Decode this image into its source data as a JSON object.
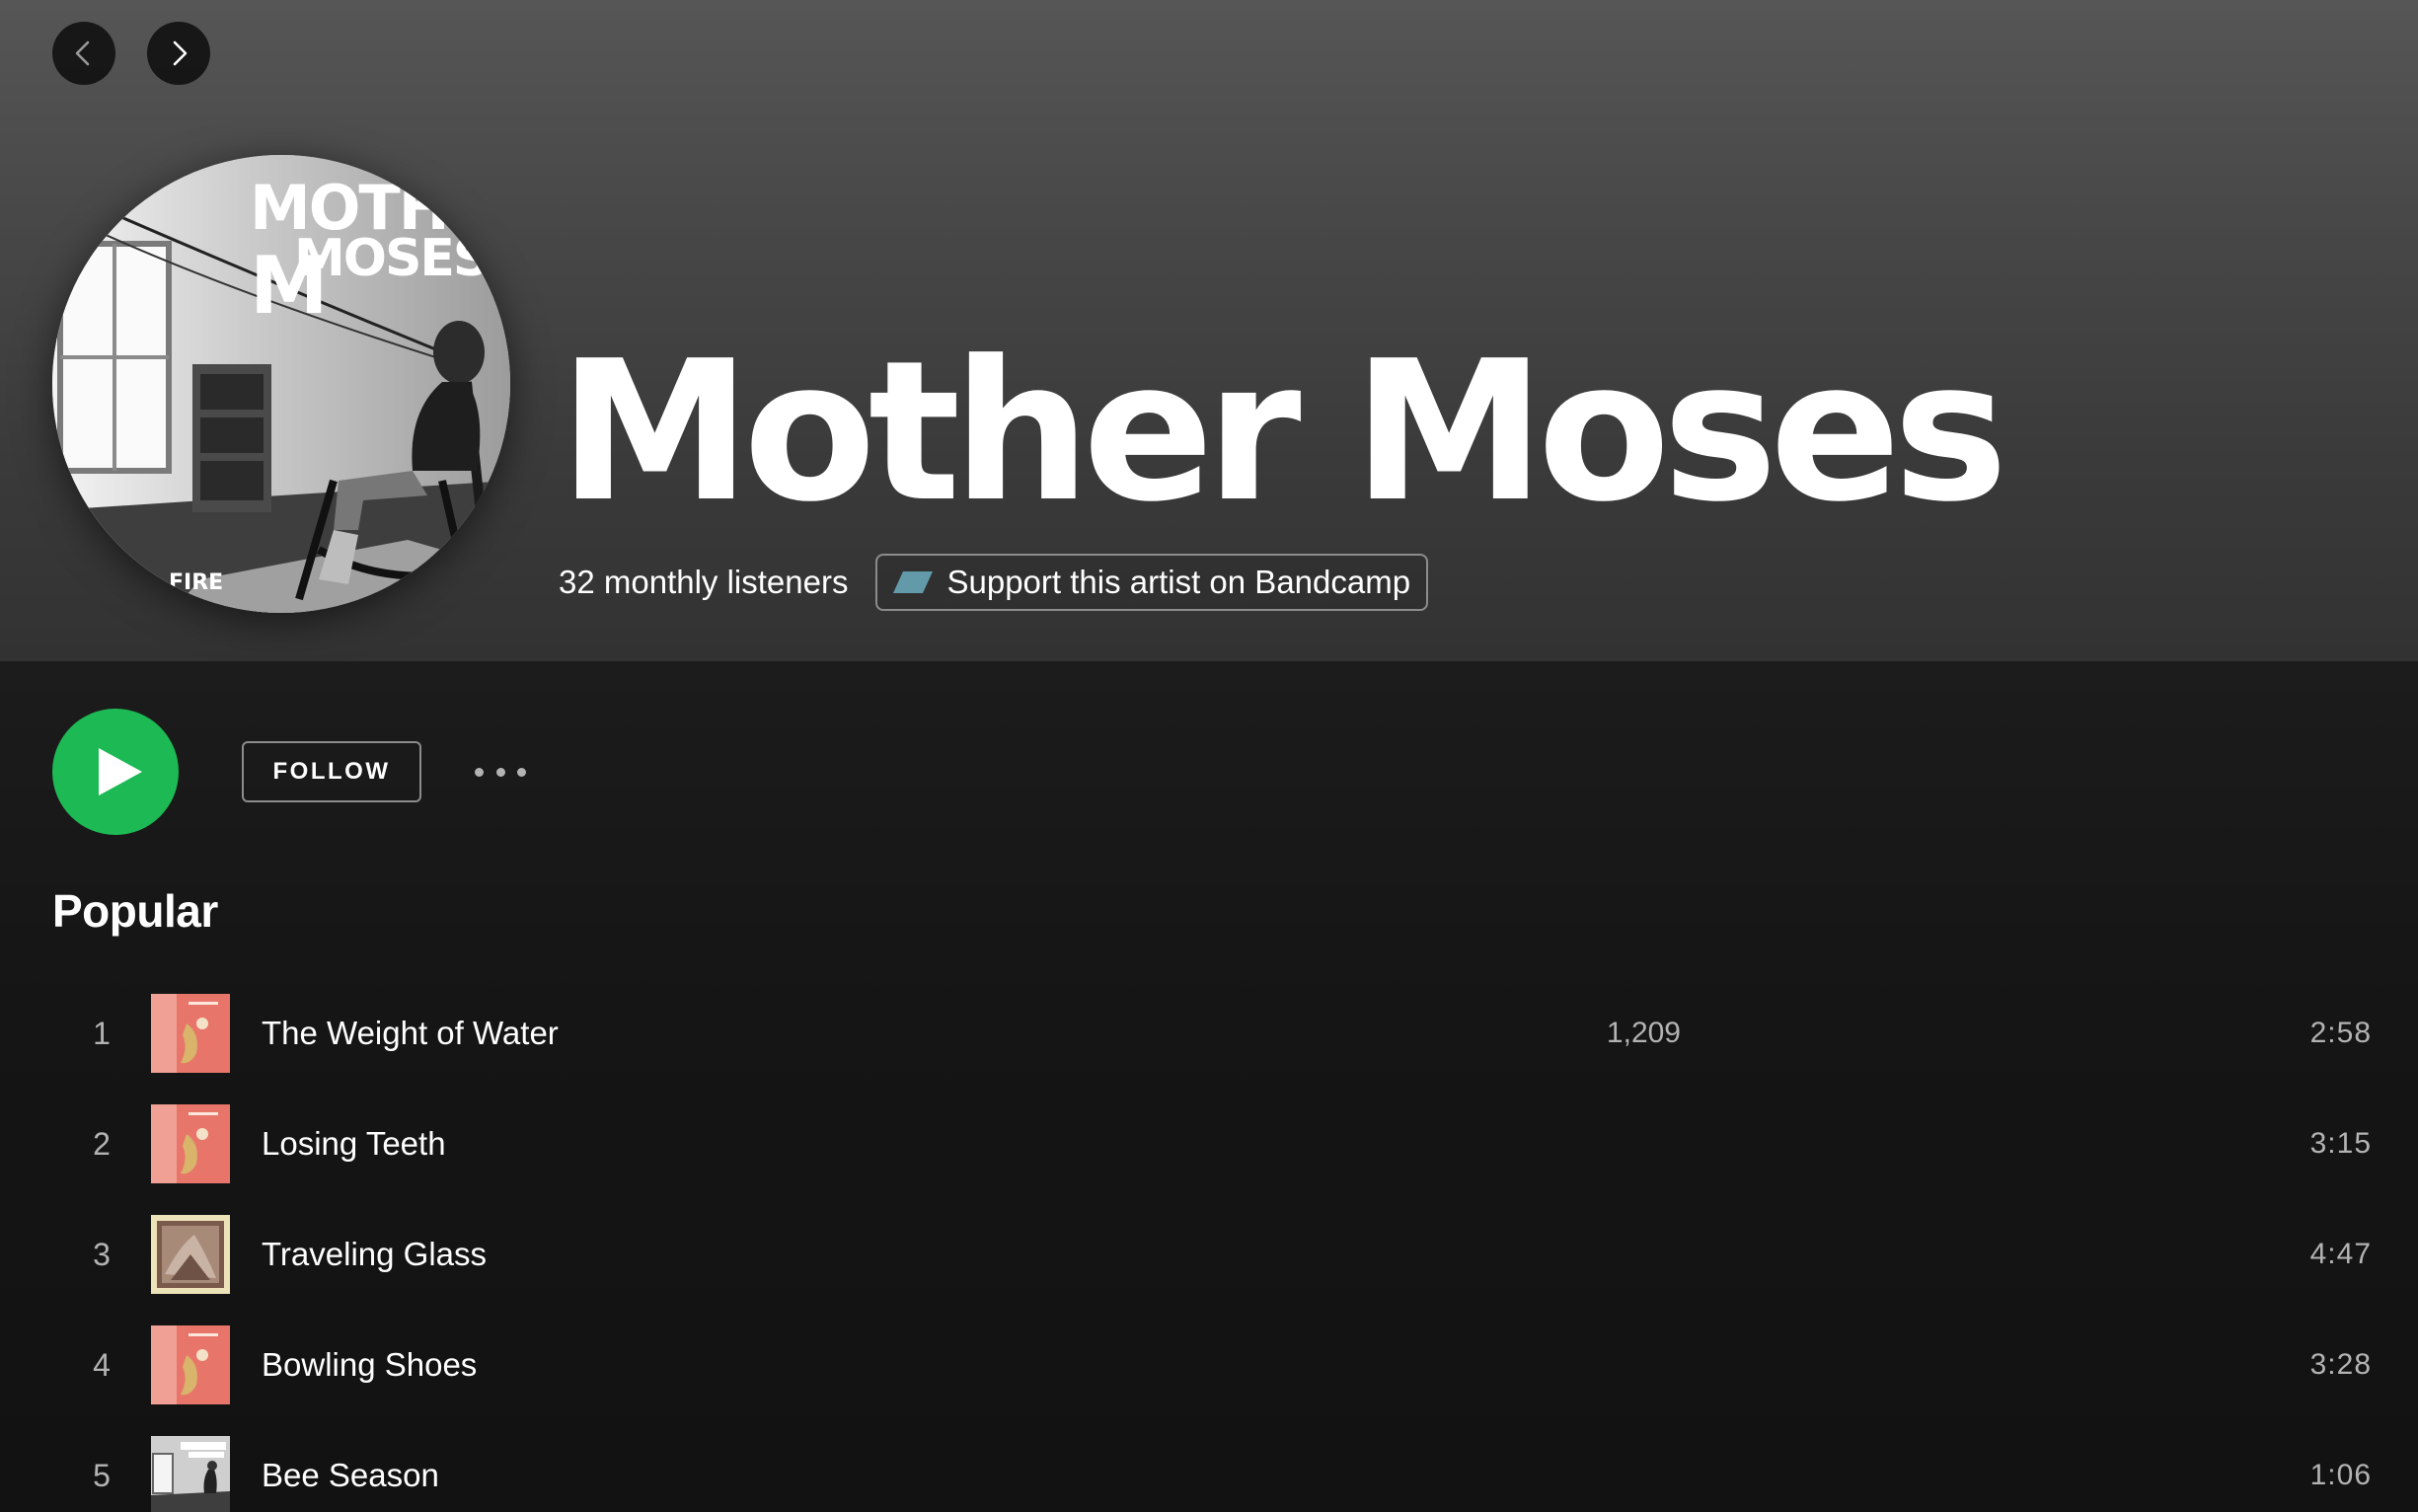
{
  "nav": {
    "back_icon": "chevron-left-icon",
    "forward_icon": "chevron-right-icon"
  },
  "artist": {
    "name": "Mother Moses",
    "monthly_listeners": "32 monthly listeners",
    "image_text_top": "MOTHER",
    "image_text_bottom": "MOSES",
    "image_text_corner": "FIRE"
  },
  "bandcamp": {
    "label": "Support this artist on Bandcamp",
    "icon": "bandcamp-icon",
    "logo_color": "#629aa9"
  },
  "actions": {
    "play_icon": "play-icon",
    "follow_label": "FOLLOW",
    "more_icon": "more-icon",
    "accent_color": "#1db954"
  },
  "popular": {
    "title": "Popular",
    "tracks": [
      {
        "number": "1",
        "title": "The Weight of Water",
        "plays": "1,209",
        "duration": "2:58",
        "art": "pink"
      },
      {
        "number": "2",
        "title": "Losing Teeth",
        "plays": "",
        "duration": "3:15",
        "art": "pink"
      },
      {
        "number": "3",
        "title": "Traveling Glass",
        "plays": "",
        "duration": "4:47",
        "art": "frame"
      },
      {
        "number": "4",
        "title": "Bowling Shoes",
        "plays": "",
        "duration": "3:28",
        "art": "pink"
      },
      {
        "number": "5",
        "title": "Bee Season",
        "plays": "",
        "duration": "1:06",
        "art": "bw"
      }
    ]
  }
}
